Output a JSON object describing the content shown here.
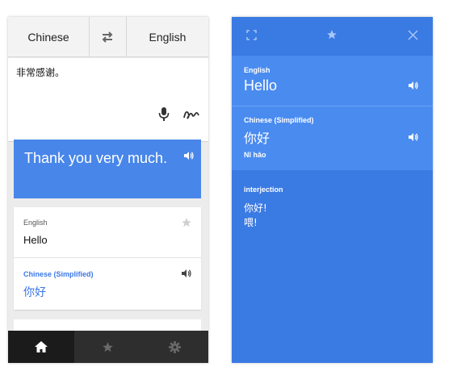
{
  "left_screen": {
    "source_language": "Chinese",
    "target_language": "English",
    "input_text": "非常感谢。",
    "translation": "Thank you very much.",
    "dictionary_card": {
      "source_label": "English",
      "source_word": "Hello",
      "target_label": "Chinese (Simplified)",
      "target_word": "你好"
    },
    "nav": [
      "home-icon",
      "star-icon",
      "gear-icon"
    ]
  },
  "right_screen": {
    "source_label": "English",
    "source_word": "Hello",
    "target_label": "Chinese (Simplified)",
    "target_word": "你好",
    "romanization": "Nǐ hǎo",
    "part_of_speech": "interjection",
    "definitions": [
      "你好!",
      "喂!"
    ]
  },
  "colors": {
    "accent_blue": "#4886ea",
    "panel_blue": "#3a7ae3",
    "nav_dark": "#2e2e2e"
  }
}
